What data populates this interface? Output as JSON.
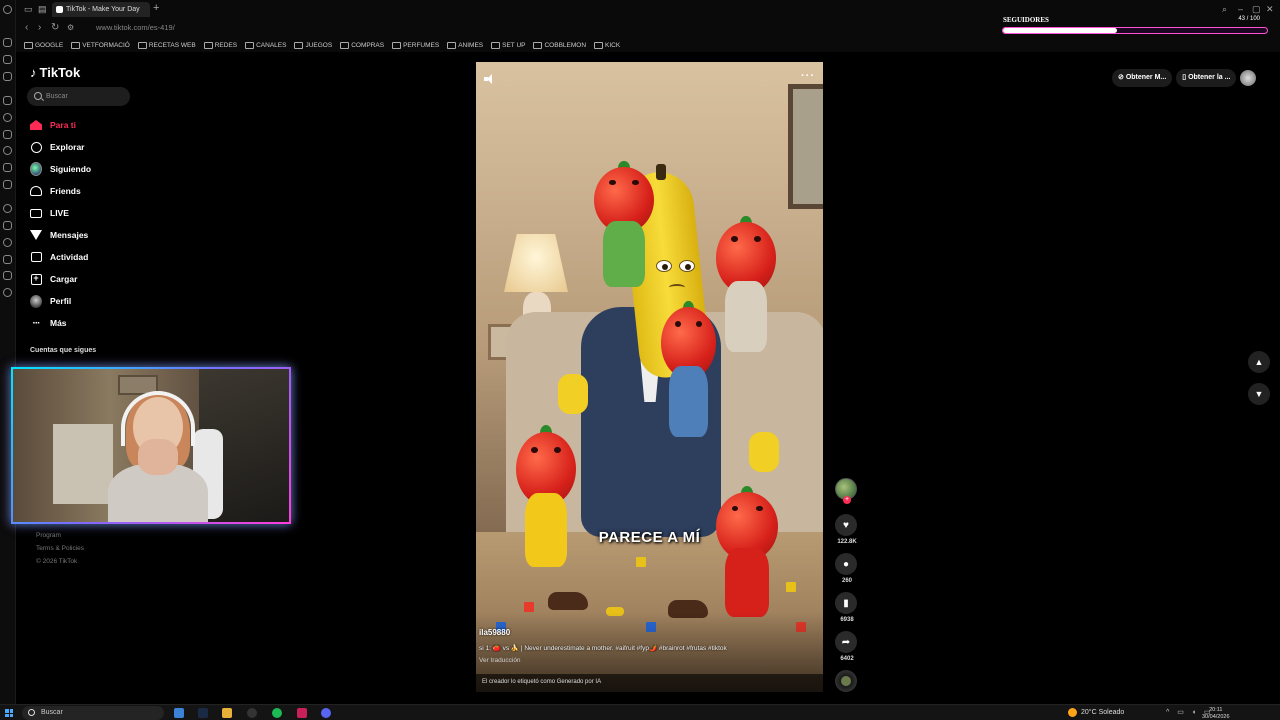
{
  "browser": {
    "tab_title": "TikTok - Make Your Day",
    "url": "www.tiktok.com/es-419/",
    "bookmarks": [
      "GOOGLE",
      "VETFORMACIÓ",
      "RECETAS WEB",
      "REDES",
      "CANALES",
      "JUEGOS",
      "COMPRAS",
      "PERFUMES",
      "ANIMES",
      "SET UP",
      "COBBLEMON",
      "KICK"
    ]
  },
  "overlay": {
    "followers_label": "SEGUIDORES",
    "followers_count": "43 / 100",
    "followers_progress": 0.43
  },
  "tiktok": {
    "logo": "TikTok",
    "search_placeholder": "Buscar",
    "nav": [
      {
        "label": "Para ti",
        "icon": "home-icon"
      },
      {
        "label": "Explorar",
        "icon": "compass-icon"
      },
      {
        "label": "Siguiendo",
        "icon": "following-avatar-icon"
      },
      {
        "label": "Friends",
        "icon": "friends-icon"
      },
      {
        "label": "LIVE",
        "icon": "live-icon"
      },
      {
        "label": "Mensajes",
        "icon": "send-icon"
      },
      {
        "label": "Actividad",
        "icon": "activity-icon"
      },
      {
        "label": "Cargar",
        "icon": "upload-icon"
      },
      {
        "label": "Perfil",
        "icon": "profile-icon"
      },
      {
        "label": "Más",
        "icon": "more-icon"
      }
    ],
    "following_title": "Cuentas que sigues",
    "footer": [
      "Program",
      "Terms & Policies",
      "© 2026 TikTok"
    ]
  },
  "video": {
    "overlay_text": "PARECE A MÍ",
    "username": "ila59880",
    "caption": "si 1: 🍅 vs 🍌 | Never underestimate a mother. #aifruit #fyp🌶️ #brainrot #frutas #tiktok",
    "translate": "Ver traducción",
    "ai_label": "El creador lo etiquetó como Generado por IA"
  },
  "actions": {
    "likes": "122.8K",
    "comments": "260",
    "saves": "6938",
    "shares": "6402"
  },
  "top_chips": [
    "Obtener M...",
    "Obtener la ..."
  ],
  "taskbar": {
    "search": "Buscar",
    "weather": "20°C  Soleado",
    "time": "20:11",
    "date": "30/04/2026"
  },
  "colors": {
    "accent": "#fe2c55",
    "webcam_border_a": "#00e5ff",
    "webcam_border_b": "#ff3ddb"
  }
}
